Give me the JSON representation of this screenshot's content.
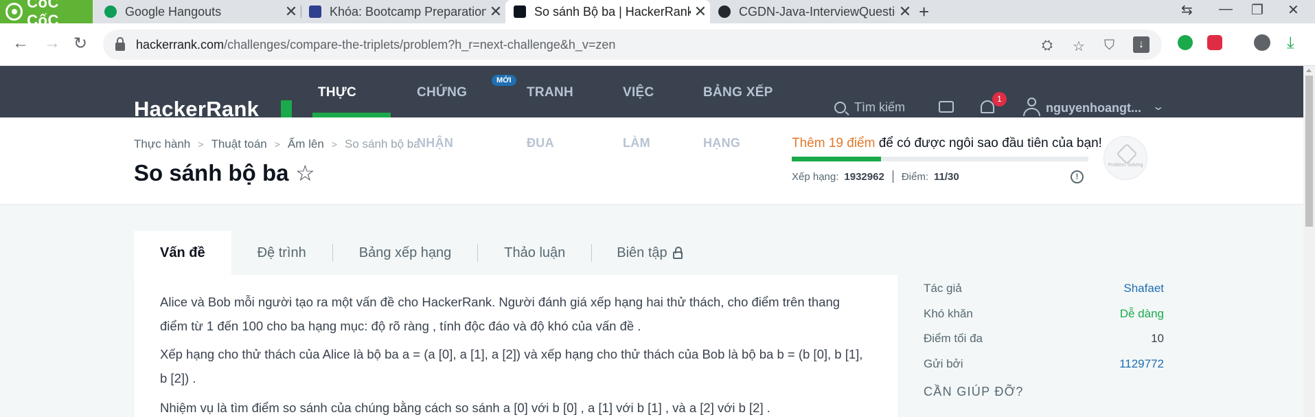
{
  "browser": {
    "brand": "CốC CốC",
    "tabs": [
      {
        "title": "Google Hangouts"
      },
      {
        "title": "Khóa: Bootcamp Preparation"
      },
      {
        "title": "So sánh Bộ ba | HackerRank"
      },
      {
        "title": "CGDN-Java-InterviewQuestion"
      }
    ],
    "url_host": "hackerrank.com",
    "url_path": "/challenges/compare-the-triplets/problem?h_r=next-challenge&h_v=zen"
  },
  "header": {
    "logo": "HackerRank",
    "nav": [
      {
        "line1": "THỰC",
        "line2": ""
      },
      {
        "line1": "CHỨNG",
        "line2": "NHẬN"
      },
      {
        "line1": "TRANH",
        "line2": "ĐUA"
      },
      {
        "line1": "VIỆC",
        "line2": "LÀM"
      },
      {
        "line1": "BẢNG XẾP",
        "line2": "HẠNG"
      }
    ],
    "new_badge": "MỚI",
    "search_placeholder": "Tìm kiếm",
    "notification_count": "1",
    "username": "nguyenhoangt..."
  },
  "subheader": {
    "breadcrumbs": [
      "Thực hành",
      "Thuật toán",
      "Ấm lên",
      "So sánh bộ ba"
    ],
    "title": "So sánh bộ ba",
    "promo_points": "Thêm 19 điểm",
    "promo_rest": "để có được ngôi sao đầu tiên của bạn!",
    "progress": 0.3,
    "rank_label": "Xếp hạng:",
    "rank_value": "1932962",
    "points_label": "Điểm:",
    "points_value": "11/30",
    "badge_label": "Problem Solving"
  },
  "problem_tabs": [
    "Vấn đề",
    "Đệ trình",
    "Bảng xếp hạng",
    "Thảo luận",
    "Biên tập"
  ],
  "problem": {
    "p1": "Alice và Bob mỗi người tạo ra một vấn đề cho HackerRank. Người đánh giá xếp hạng hai thử thách, cho điểm trên thang điểm từ 1 đến 100 cho ba hạng mục: độ rõ ràng , tính độc đáo và độ khó của vấn đề .",
    "p2": "Xếp hạng cho thử thách của Alice là bộ ba a = (a [0], a [1], a [2]) và xếp hạng cho thử thách của Bob là bộ ba b = (b [0], b [1], b [2]) .",
    "p3": "Nhiệm vụ là tìm điểm so sánh của chúng bằng cách so sánh a [0] với b [0] , a [1] với b [1] , và a [2] với b [2] ."
  },
  "sidebar": {
    "rows": [
      {
        "k": "Tác giả",
        "v": "Shafaet"
      },
      {
        "k": "Khó khăn",
        "v": "Dễ dàng"
      },
      {
        "k": "Điểm tối đa",
        "v": "10"
      },
      {
        "k": "Gửi bởi",
        "v": "1129772"
      }
    ],
    "help": "CẦN GIÚP ĐỠ?"
  },
  "colors": {
    "nav_bg": "#39424e",
    "green": "#1ba94c",
    "link": "#1f6fb2",
    "orange": "#e07a2c"
  }
}
